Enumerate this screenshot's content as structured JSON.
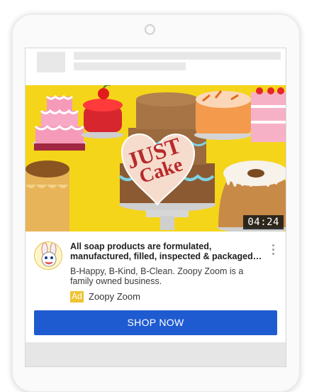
{
  "video": {
    "title_lines": [
      "JUST",
      "Cake"
    ],
    "duration": "04:24"
  },
  "ad": {
    "headline": "All soap products are formulated, manufactured, filled, inspected & packaged…",
    "description": "B-Happy, B-Kind, B-Clean. Zoopy Zoom is a family owned business.",
    "badge": "Ad",
    "advertiser": "Zoopy Zoom",
    "cta": "SHOP NOW"
  },
  "colors": {
    "cta": "#1f5bd0",
    "ad_badge": "#efc433",
    "video_background": "#f4d51a",
    "title_text": "#b82a2a"
  },
  "icons": [
    "more-vert-icon",
    "advertiser-logo"
  ]
}
